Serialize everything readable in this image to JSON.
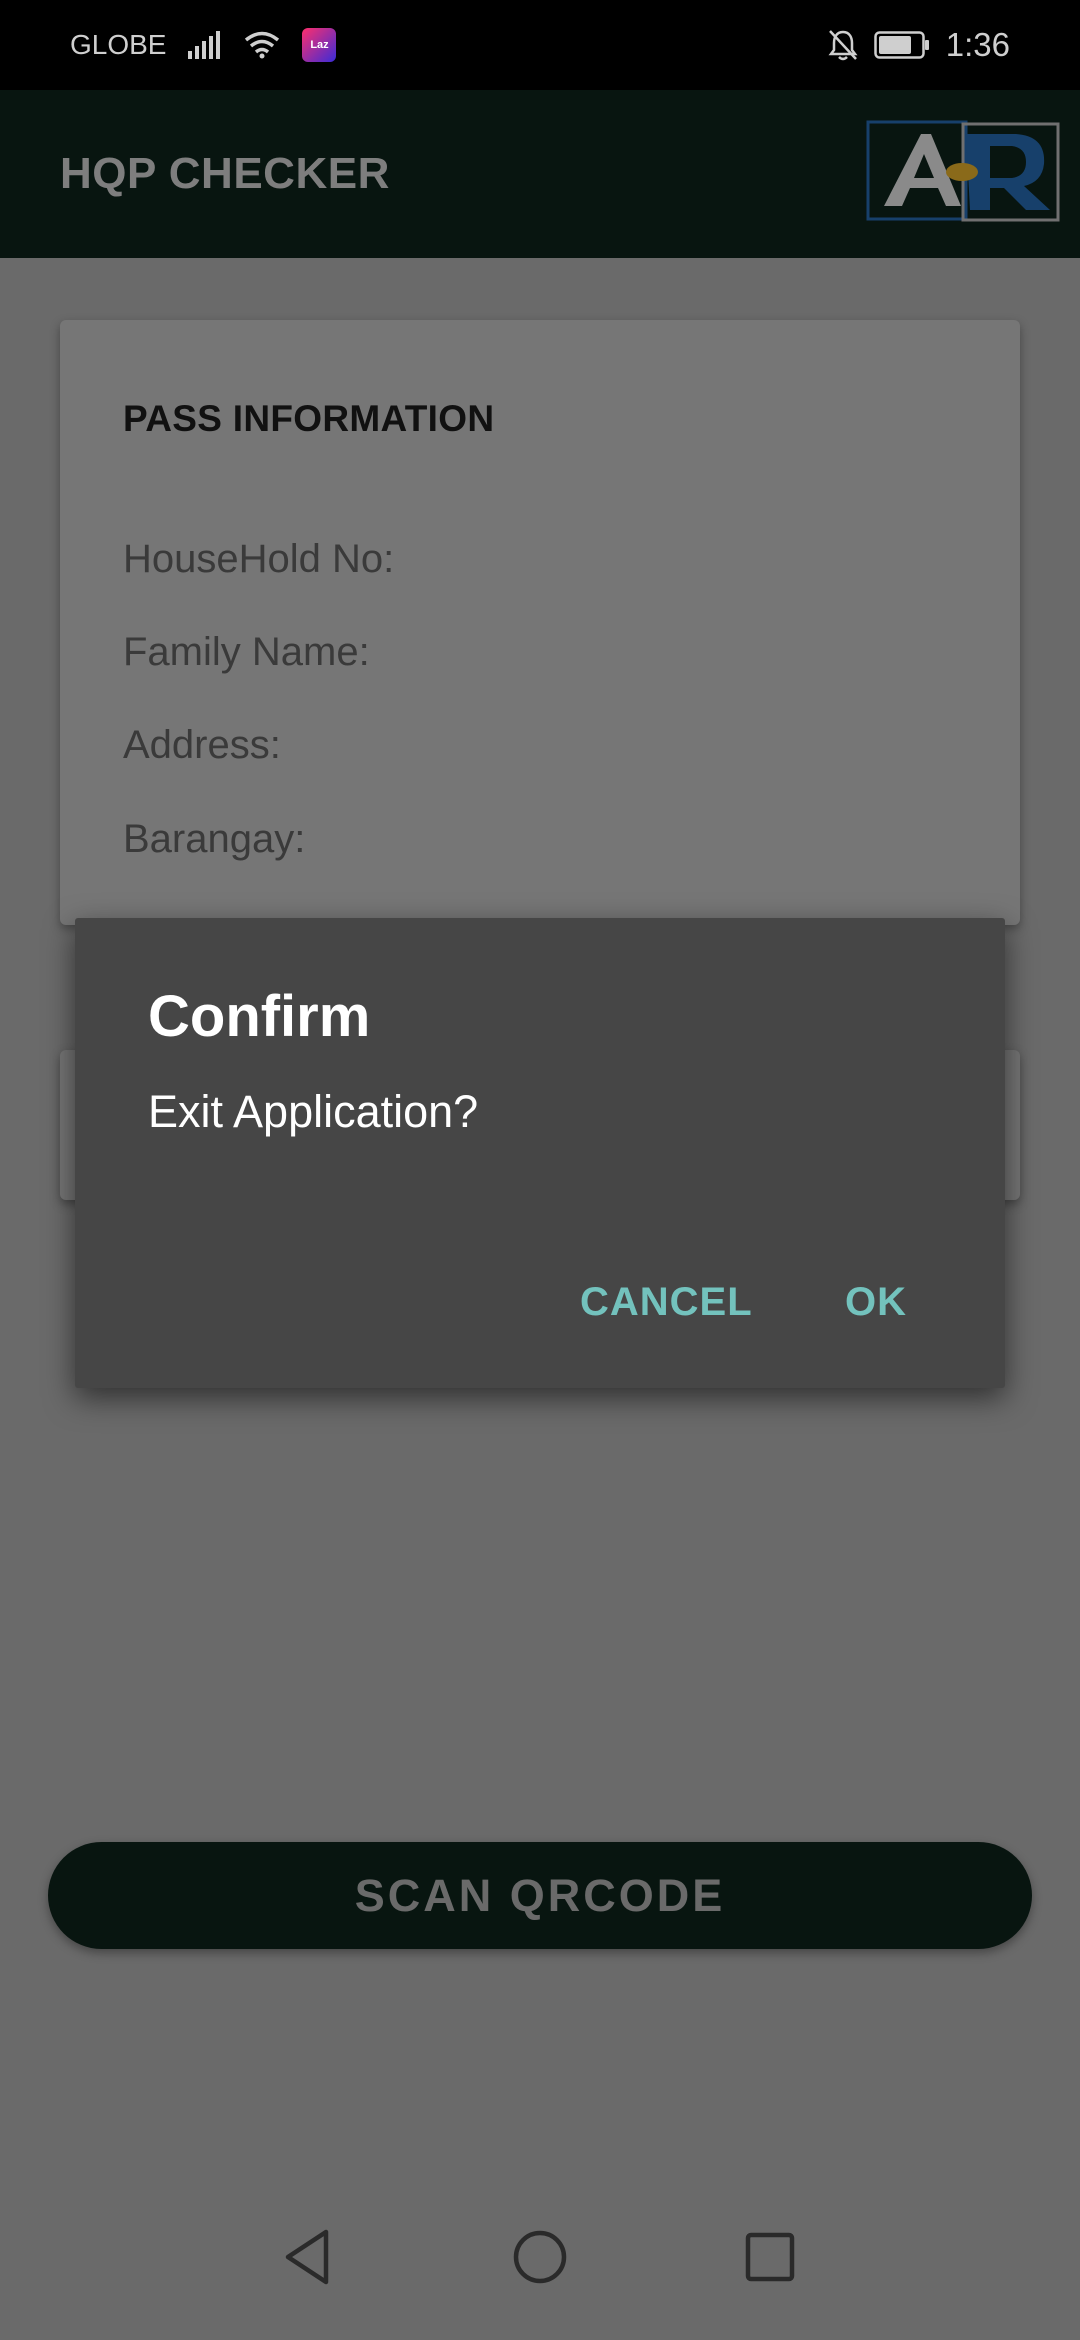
{
  "status_bar": {
    "carrier": "GLOBE",
    "laz_label": "Laz",
    "time": "1:36"
  },
  "app_bar": {
    "title": "HQP CHECKER",
    "logo_icon": "ar-logo-icon"
  },
  "card": {
    "title": "PASS INFORMATION",
    "fields": [
      "HouseHold No:",
      "Family Name:",
      "Address:",
      "Barangay:"
    ]
  },
  "dialog": {
    "title": "Confirm",
    "message": "Exit Application?",
    "cancel_label": "CANCEL",
    "ok_label": "OK"
  },
  "scan_button": {
    "label": "SCAN QRCODE"
  },
  "colors": {
    "app_bar": "#081510",
    "dialog_bg": "#464646",
    "dialog_button": "#73c2bd",
    "scrim": "#6a6a6a"
  },
  "nav": {
    "icons": [
      "back-icon",
      "home-icon",
      "recents-icon"
    ]
  }
}
